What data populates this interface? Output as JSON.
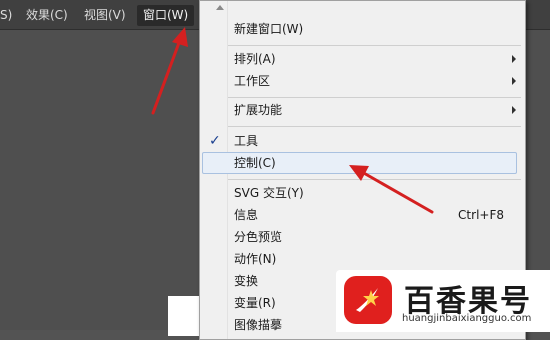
{
  "menubar": {
    "items": [
      {
        "label": "S)"
      },
      {
        "label": "效果(C)"
      },
      {
        "label": "视图(V)"
      },
      {
        "label": "窗口(W)"
      }
    ]
  },
  "window_menu": {
    "items": [
      {
        "label": "新建窗口(W)"
      },
      {
        "label": "排列(A)",
        "has_submenu": true
      },
      {
        "label": "工作区",
        "has_submenu": true
      },
      {
        "label": "扩展功能",
        "has_submenu": true
      },
      {
        "label": "工具",
        "checked": true
      },
      {
        "label": "控制(C)",
        "highlighted": true
      },
      {
        "label": "SVG 交互(Y)"
      },
      {
        "label": "信息",
        "shortcut": "Ctrl+F8"
      },
      {
        "label": "分色预览"
      },
      {
        "label": "动作(N)"
      },
      {
        "label": "变换"
      },
      {
        "label": "变量(R)"
      },
      {
        "label": "图像描摹"
      }
    ]
  },
  "watermark": {
    "title": "百香果号",
    "url": "huangjinbaixiangguo.com"
  },
  "colors": {
    "annotation_arrow": "#d42020",
    "logo_red": "#e0201e"
  }
}
